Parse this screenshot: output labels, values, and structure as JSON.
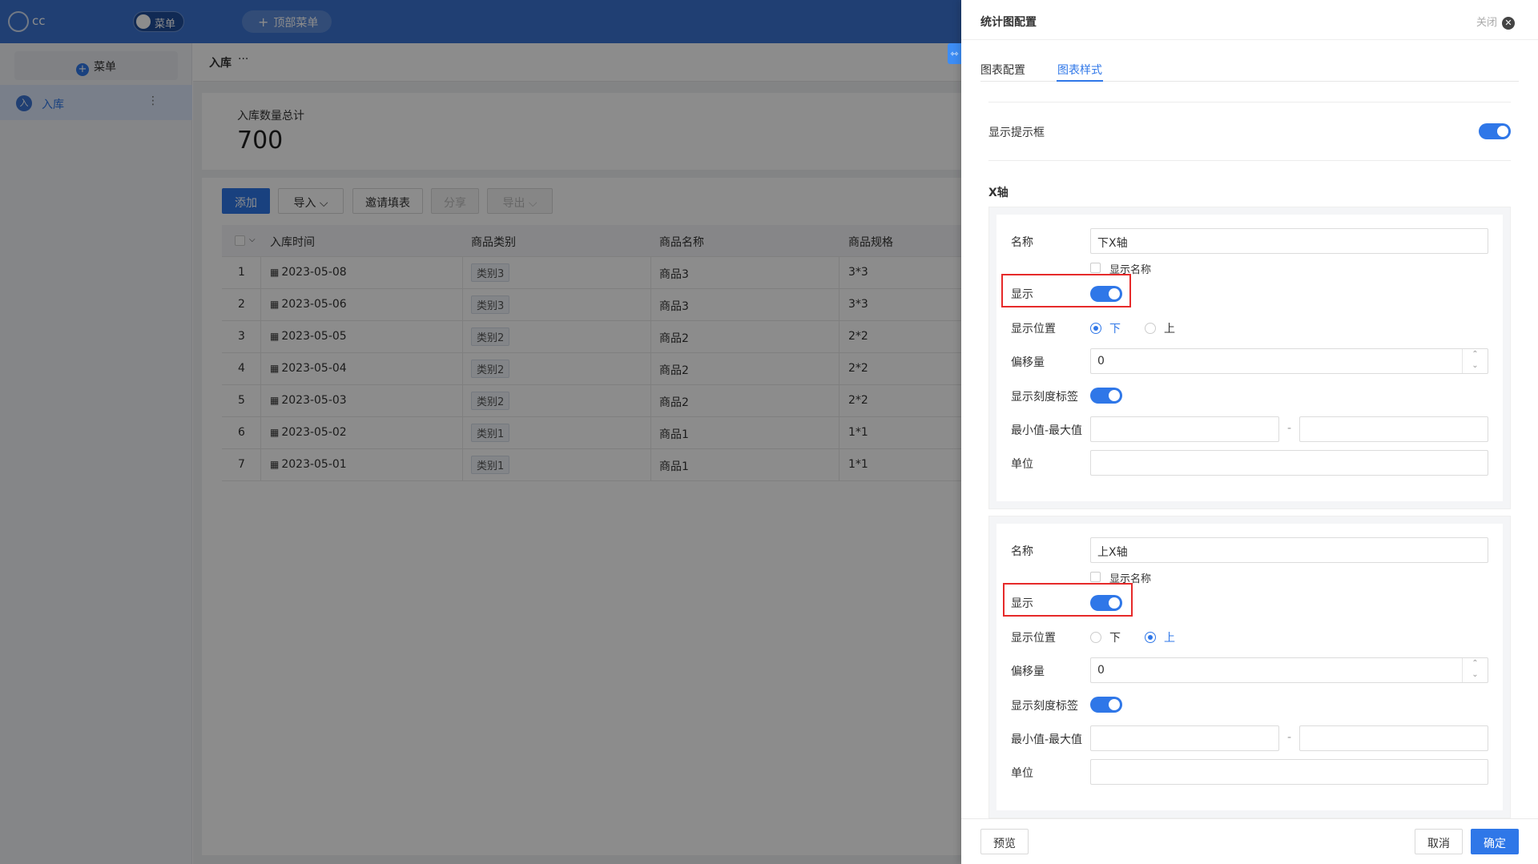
{
  "app": {
    "name": "cc",
    "menu_toggle_label": "菜单",
    "top_menu_label": "顶部菜单"
  },
  "sidebar": {
    "add_label": "菜单",
    "items": [
      {
        "avatar": "入",
        "label": "入库"
      }
    ]
  },
  "breadcrumb": {
    "title": "入库",
    "more": "···"
  },
  "stat": {
    "label": "入库数量总计",
    "value": "700"
  },
  "toolbar": {
    "add": "添加",
    "import": "导入",
    "invite": "邀请填表",
    "share": "分享",
    "export": "导出"
  },
  "table": {
    "columns": [
      "入库时间",
      "商品类别",
      "商品名称",
      "商品规格"
    ],
    "rows": [
      {
        "idx": "1",
        "date": "2023-05-08",
        "category": "类别3",
        "name": "商品3",
        "spec": "3*3"
      },
      {
        "idx": "2",
        "date": "2023-05-06",
        "category": "类别3",
        "name": "商品3",
        "spec": "3*3"
      },
      {
        "idx": "3",
        "date": "2023-05-05",
        "category": "类别2",
        "name": "商品2",
        "spec": "2*2"
      },
      {
        "idx": "4",
        "date": "2023-05-04",
        "category": "类别2",
        "name": "商品2",
        "spec": "2*2"
      },
      {
        "idx": "5",
        "date": "2023-05-03",
        "category": "类别2",
        "name": "商品2",
        "spec": "2*2"
      },
      {
        "idx": "6",
        "date": "2023-05-02",
        "category": "类别1",
        "name": "商品1",
        "spec": "1*1"
      },
      {
        "idx": "7",
        "date": "2023-05-01",
        "category": "类别1",
        "name": "商品1",
        "spec": "1*1"
      }
    ]
  },
  "drawer": {
    "title": "统计图配置",
    "close_label": "关闭",
    "tabs": [
      "图表配置",
      "图表样式"
    ],
    "active_tab": "图表样式",
    "show_tooltip_label": "显示提示框",
    "show_tooltip": true,
    "xaxis_section": "X轴",
    "labels": {
      "name": "名称",
      "show_name": "显示名称",
      "show": "显示",
      "position": "显示位置",
      "pos_bottom": "下",
      "pos_top": "上",
      "offset": "偏移量",
      "show_ticks": "显示刻度标签",
      "min_max": "最小值-最大值",
      "unit": "单位",
      "range_sep": "-"
    },
    "axes": [
      {
        "name": "下X轴",
        "show_name": false,
        "show": true,
        "position": "下",
        "offset": "0",
        "show_ticks": true,
        "min": "",
        "max": "",
        "unit": ""
      },
      {
        "name": "上X轴",
        "show_name": false,
        "show": true,
        "position": "上",
        "offset": "0",
        "show_ticks": true,
        "min": "",
        "max": "",
        "unit": ""
      }
    ],
    "footer": {
      "preview": "预览",
      "cancel": "取消",
      "confirm": "确定"
    }
  },
  "colors": {
    "primary": "#2f77e8",
    "topbar": "#3b74d1",
    "highlight": "#e62a2a"
  }
}
